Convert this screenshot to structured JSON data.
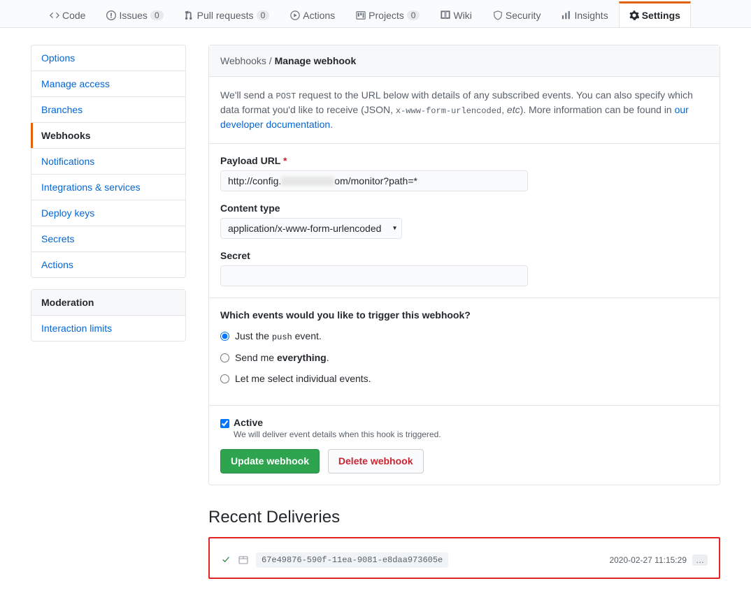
{
  "nav": {
    "code": "Code",
    "issues": "Issues",
    "issues_count": "0",
    "pulls": "Pull requests",
    "pulls_count": "0",
    "actions": "Actions",
    "projects": "Projects",
    "projects_count": "0",
    "wiki": "Wiki",
    "security": "Security",
    "insights": "Insights",
    "settings": "Settings"
  },
  "sidebar": {
    "options": "Options",
    "manage_access": "Manage access",
    "branches": "Branches",
    "webhooks": "Webhooks",
    "notifications": "Notifications",
    "integrations": "Integrations & services",
    "deploy_keys": "Deploy keys",
    "secrets": "Secrets",
    "actions": "Actions",
    "moderation_heading": "Moderation",
    "interaction_limits": "Interaction limits"
  },
  "header": {
    "crumb_root": "Webhooks",
    "sep": " / ",
    "crumb_leaf": "Manage webhook"
  },
  "intro": {
    "pre": "We'll send a ",
    "post_code": "POST",
    "mid1": " request to the URL below with details of any subscribed events. You can also specify which data format you'd like to receive (JSON, ",
    "code2": "x-www-form-urlencoded",
    "mid2": ", ",
    "em": "etc",
    "mid3": "). More information can be found in ",
    "link": "our developer documentation",
    "tail": "."
  },
  "form": {
    "payload_label": "Payload URL",
    "required_mark": "*",
    "payload_prefix": "http://config.",
    "payload_suffix": "om/monitor?path=*",
    "content_type_label": "Content type",
    "content_type_value": "application/x-www-form-urlencoded",
    "secret_label": "Secret",
    "secret_value": ""
  },
  "events": {
    "question": "Which events would you like to trigger this webhook?",
    "opt_push_pre": "Just the ",
    "opt_push_code": "push",
    "opt_push_post": " event.",
    "opt_everything_pre": "Send me ",
    "opt_everything_b": "everything",
    "opt_everything_post": ".",
    "opt_individual": "Let me select individual events."
  },
  "active": {
    "label": "Active",
    "note": "We will deliver event details when this hook is triggered."
  },
  "buttons": {
    "update": "Update webhook",
    "delete": "Delete webhook"
  },
  "deliveries": {
    "heading": "Recent Deliveries",
    "item_id": "67e49876-590f-11ea-9081-e8daa973605e",
    "item_time": "2020-02-27 11:15:29",
    "ellipsis": "…"
  }
}
